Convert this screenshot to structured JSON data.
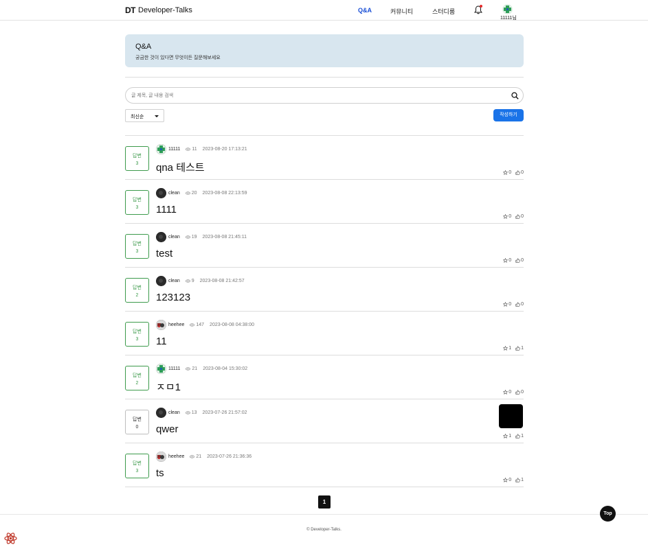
{
  "header": {
    "logo_mark": "DT",
    "logo_name": "Developer-Talks",
    "nav": [
      {
        "label": "Q&A",
        "active": true
      },
      {
        "label": "커뮤니티",
        "active": false
      },
      {
        "label": "스터디룸",
        "active": false
      }
    ],
    "user_name": "11111님"
  },
  "banner": {
    "title": "Q&A",
    "subtitle": "궁금한 것이 있다면 무엇이든 질문해보세요"
  },
  "search": {
    "placeholder": "글 제목, 글 내용 검색",
    "value": ""
  },
  "sort": {
    "selected": "최신순"
  },
  "write_button": "작성하기",
  "answer_label": "답변",
  "posts": [
    {
      "answers": "3",
      "author": "11111",
      "avatar": "green",
      "views": "11",
      "date": "2023-08-20 17:13:21",
      "title": "qna 테스트",
      "stars": "0",
      "likes": "0"
    },
    {
      "answers": "3",
      "author": "clean",
      "avatar": "dark",
      "views": "20",
      "date": "2023-08-08 22:13:59",
      "title": "1111",
      "stars": "0",
      "likes": "0"
    },
    {
      "answers": "3",
      "author": "clean",
      "avatar": "dark",
      "views": "19",
      "date": "2023-08-08 21:45:11",
      "title": "test",
      "stars": "0",
      "likes": "0"
    },
    {
      "answers": "2",
      "author": "clean",
      "avatar": "dark",
      "views": "9",
      "date": "2023-08-08 21:42:57",
      "title": "123123",
      "stars": "0",
      "likes": "0"
    },
    {
      "answers": "3",
      "author": "heehee",
      "avatar": "photo",
      "views": "147",
      "date": "2023-08-08 04:38:00",
      "title": "11",
      "stars": "1",
      "likes": "1"
    },
    {
      "answers": "2",
      "author": "11111",
      "avatar": "green",
      "views": "21",
      "date": "2023-08-04 15:30:02",
      "title": "ㅈㅁ1",
      "stars": "0",
      "likes": "0"
    },
    {
      "answers": "0",
      "author": "clean",
      "avatar": "dark",
      "views": "13",
      "date": "2023-07-26 21:57:02",
      "title": "qwer",
      "stars": "1",
      "likes": "1",
      "has_thumbnail": true
    },
    {
      "answers": "3",
      "author": "heehee",
      "avatar": "photo",
      "views": "21",
      "date": "2023-07-26 21:36:36",
      "title": "ts",
      "stars": "0",
      "likes": "1"
    }
  ],
  "pagination": {
    "current": "1"
  },
  "top_button": "Top",
  "footer": {
    "copyright": "© Developer-Talks."
  },
  "colors": {
    "accent": "#1a73e8",
    "nav_active": "#1a4fd6",
    "answer_green": "#3c9a4b",
    "banner_bg": "#d8e6ef"
  }
}
